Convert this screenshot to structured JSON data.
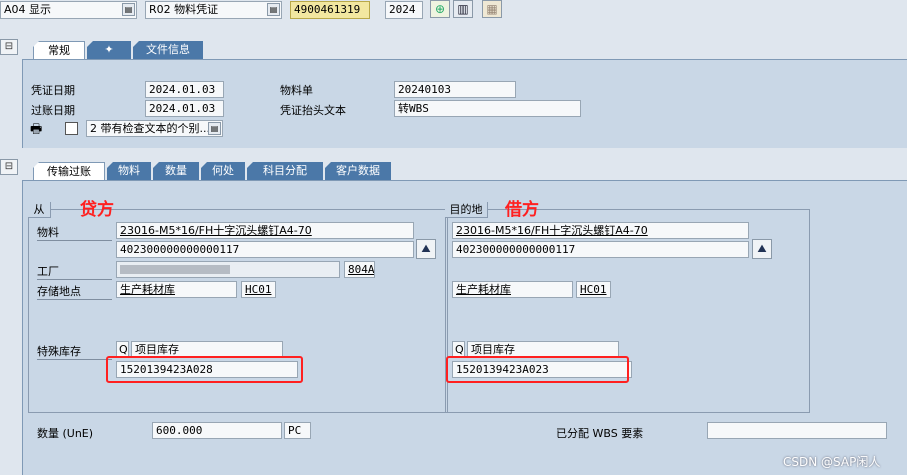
{
  "toolbar": {
    "action": "A04 显示",
    "reference": "R02 物料凭证",
    "doc_number": "4900461319",
    "year": "2024",
    "dd_icon": "dropdown-icon",
    "execute_icon": "execute-icon",
    "glasses_icon": "display-icon",
    "grid_icon": "grid-icon"
  },
  "header": {
    "tabs": [
      "常规",
      "",
      "文件信息"
    ],
    "doc_date_label": "凭证日期",
    "doc_date": "2024.01.03",
    "post_date_label": "过账日期",
    "post_date": "2024.01.03",
    "material_slip_label": "物料单",
    "material_slip": "20240103",
    "header_text_label": "凭证抬头文本",
    "header_text": "转WBS",
    "print_option": "2 带有检查文本的个别..."
  },
  "item": {
    "tabs": [
      "传输过账",
      "物料",
      "数量",
      "何处",
      "科目分配",
      "客户数据"
    ],
    "from": {
      "title": "从",
      "annotation": "贷方",
      "material_label": "物料",
      "material_desc": "23016-M5*16/FH十字沉头螺钉A4-70",
      "material_no": "402300000000000117",
      "plant_label": "工厂",
      "plant_code": "804A",
      "sloc_label": "存储地点",
      "sloc_desc": "生产耗材库",
      "sloc_code": "HC01",
      "special_stock_label": "特殊库存",
      "special_stock_ind": "Q",
      "special_stock_desc": "项目库存",
      "wbs": "1520139423A028"
    },
    "to": {
      "title": "目的地",
      "annotation": "借方",
      "material_desc": "23016-M5*16/FH十字沉头螺钉A4-70",
      "material_no": "402300000000000117",
      "sloc_desc": "生产耗材库",
      "sloc_code": "HC01",
      "special_stock_ind": "Q",
      "special_stock_desc": "项目库存",
      "wbs": "1520139423A023"
    },
    "qty_label": "数量 (UnE)",
    "qty": "600.000",
    "unit": "PC",
    "wbs_elements_label": "已分配 WBS 要素"
  },
  "watermark": "CSDN @SAP闲人",
  "colors": {
    "highlight": "#ff2020",
    "tab_active": "#ffffff",
    "tab_inactive": "#4b78a8",
    "panel": "#c9d7e6"
  }
}
